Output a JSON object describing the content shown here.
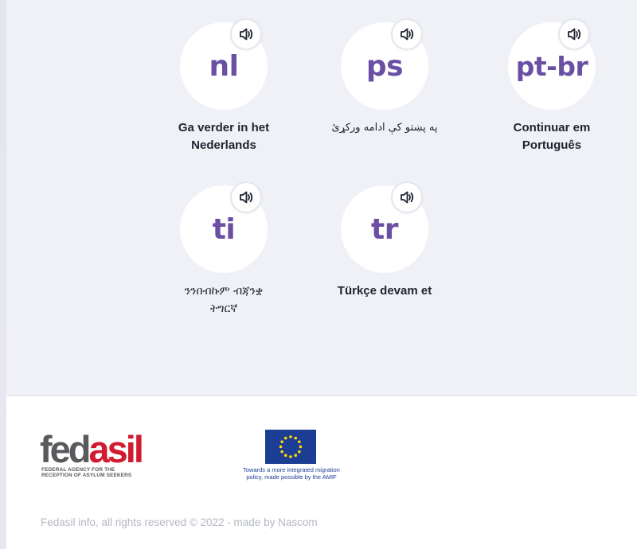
{
  "languages": [
    {
      "code": "nl",
      "label": "Ga verder in het Nederlands"
    },
    {
      "code": "ps",
      "label": "په پښتو کې ادامه ورکړئ"
    },
    {
      "code": "pt-br",
      "label": "Continuar em Português"
    },
    {
      "code": "ti",
      "label": "ንንበብኩም ብጃንቋ ትግርኛ"
    },
    {
      "code": "tr",
      "label": "Türkçe devam et"
    }
  ],
  "icons": {
    "audio": "speaker-icon"
  },
  "footer": {
    "fedasil": {
      "brand_part1": "fed",
      "brand_part2": "asil",
      "tagline_line1": "FEDERAL AGENCY FOR THE",
      "tagline_line2": "RECEPTION OF ASYLUM SEEKERS"
    },
    "eu": {
      "caption_line1": "Towards a more integrated migration",
      "caption_line2": "policy, made possible by the AMIF"
    },
    "copyright": "Fedasil info, all rights reserved © 2022 - made by Nascom"
  },
  "colors": {
    "accent_purple": "#6a4fa3",
    "section_bg": "#eff1f6",
    "fedasil_red": "#d11c2f",
    "fedasil_gray": "#5a5a5e",
    "eu_blue": "#1b3d93",
    "eu_star": "#ffdd00"
  }
}
